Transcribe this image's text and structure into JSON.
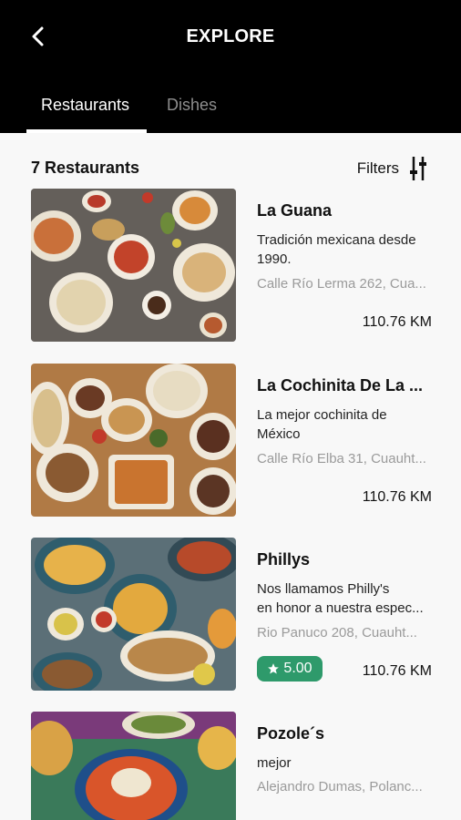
{
  "header": {
    "title": "EXPLORE",
    "back_icon": "chevron-left-icon",
    "tabs": [
      {
        "label": "Restaurants",
        "active": true
      },
      {
        "label": "Dishes",
        "active": false
      }
    ]
  },
  "list": {
    "count_label": "7 Restaurants",
    "filters_label": "Filters",
    "filters_icon": "sliders-icon",
    "items": [
      {
        "name": "La Guana",
        "desc": [
          "Tradición mexicana desde",
          "1990."
        ],
        "address": "Calle Río Lerma 262, Cua...",
        "distance": "110.76 KM"
      },
      {
        "name": "La Cochinita De La ...",
        "desc": [
          "La mejor cochinita de",
          "México"
        ],
        "address": "Calle Río Elba 31, Cuauht...",
        "distance": "110.76 KM"
      },
      {
        "name": "Phillys",
        "desc": [
          "Nos llamamos Philly's",
          "en honor a nuestra espec..."
        ],
        "address": "Rio Panuco 208, Cuauht...",
        "distance": "110.76 KM",
        "rating": "5.00"
      },
      {
        "name": "Pozole´s",
        "desc": [
          "mejor"
        ],
        "address": "Alejandro Dumas, Polanc...",
        "distance": ""
      }
    ]
  },
  "colors": {
    "header_bg": "#000000",
    "rating_bg": "#2e9a6b",
    "muted_text": "#9a9a9a"
  }
}
